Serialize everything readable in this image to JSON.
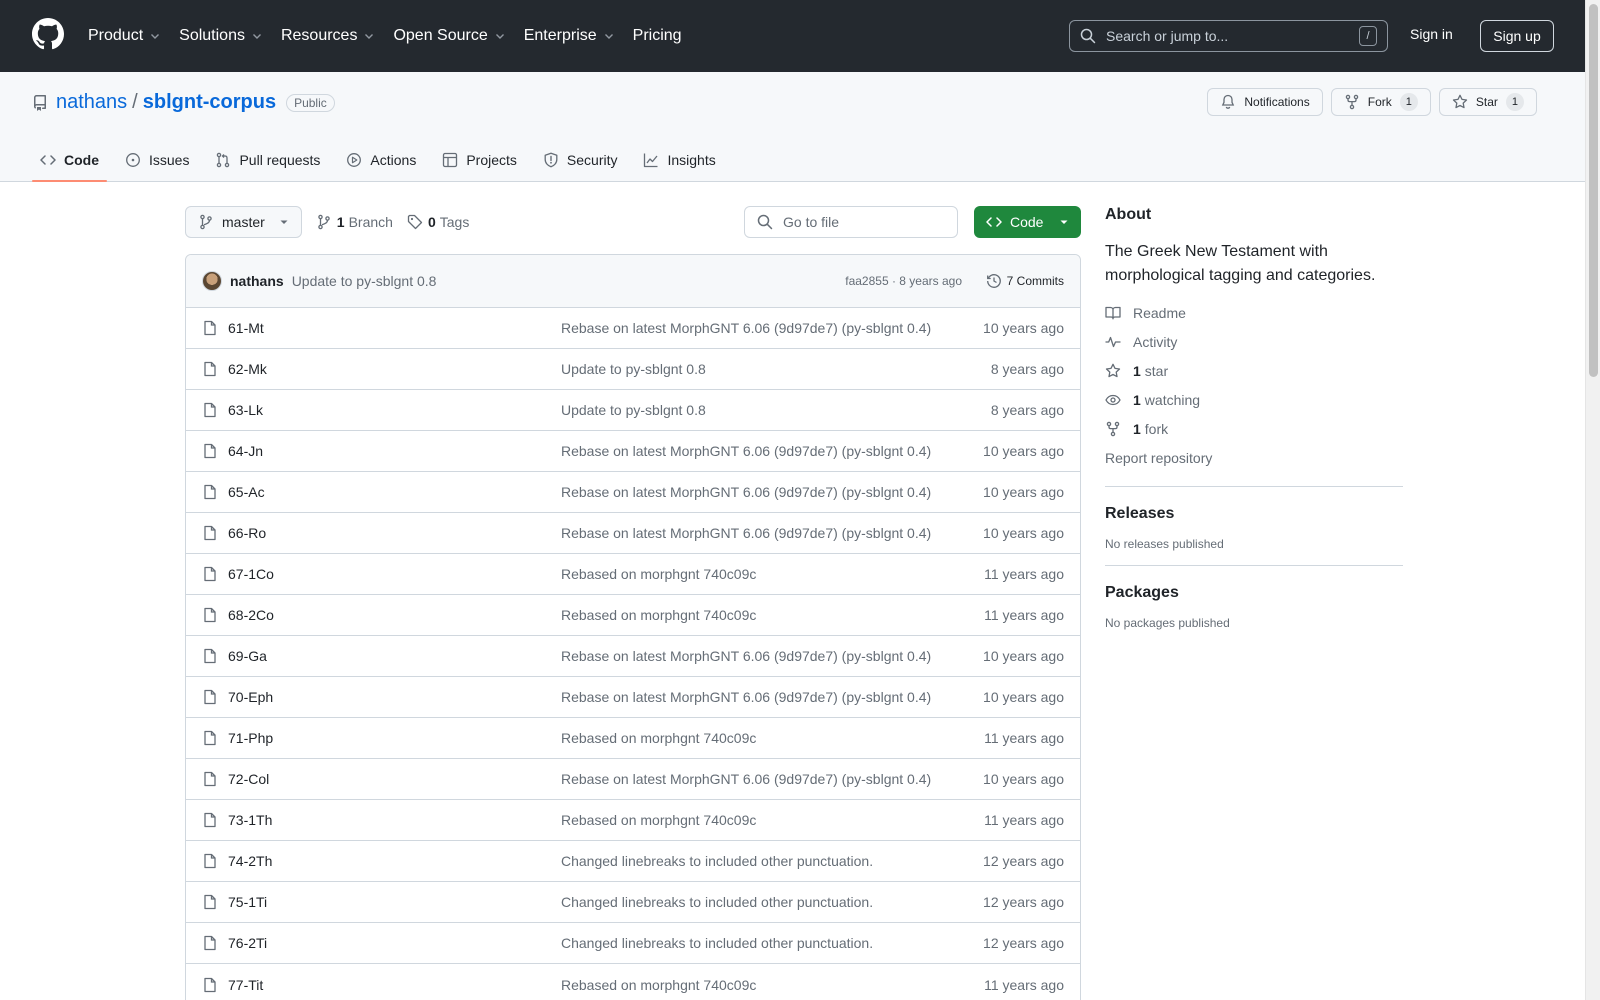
{
  "header": {
    "nav": [
      {
        "label": "Product",
        "has_menu": true
      },
      {
        "label": "Solutions",
        "has_menu": true
      },
      {
        "label": "Resources",
        "has_menu": true
      },
      {
        "label": "Open Source",
        "has_menu": true
      },
      {
        "label": "Enterprise",
        "has_menu": true
      },
      {
        "label": "Pricing",
        "has_menu": false
      }
    ],
    "search_placeholder": "Search or jump to...",
    "search_shortcut": "/",
    "sign_in": "Sign in",
    "sign_up": "Sign up"
  },
  "repo": {
    "owner": "nathans",
    "separator": "/",
    "name": "sblgnt-corpus",
    "visibility": "Public",
    "notifications_label": "Notifications",
    "fork_label": "Fork",
    "fork_count": "1",
    "star_label": "Star",
    "star_count": "1",
    "tabs": [
      {
        "label": "Code",
        "icon": "code-icon",
        "active": true
      },
      {
        "label": "Issues",
        "icon": "issue-icon",
        "active": false
      },
      {
        "label": "Pull requests",
        "icon": "pull-request-icon",
        "active": false
      },
      {
        "label": "Actions",
        "icon": "play-icon",
        "active": false
      },
      {
        "label": "Projects",
        "icon": "table-icon",
        "active": false
      },
      {
        "label": "Security",
        "icon": "shield-icon",
        "active": false
      },
      {
        "label": "Insights",
        "icon": "graph-icon",
        "active": false
      }
    ]
  },
  "file_nav": {
    "branch": "master",
    "branch_count": "1",
    "branch_label": "Branch",
    "tag_count": "0",
    "tag_label": "Tags",
    "goto_placeholder": "Go to file",
    "code_button": "Code"
  },
  "latest_commit": {
    "author": "nathans",
    "message": "Update to py-sblgnt 0.8",
    "meta": "faa2855 · 8 years ago",
    "commits_label": "7 Commits"
  },
  "files": [
    {
      "name": "61-Mt",
      "commit": "Rebase on latest MorphGNT 6.06 (9d97de7) (py-sblgnt 0.4)",
      "age": "10 years ago"
    },
    {
      "name": "62-Mk",
      "commit": "Update to py-sblgnt 0.8",
      "age": "8 years ago"
    },
    {
      "name": "63-Lk",
      "commit": "Update to py-sblgnt 0.8",
      "age": "8 years ago"
    },
    {
      "name": "64-Jn",
      "commit": "Rebase on latest MorphGNT 6.06 (9d97de7) (py-sblgnt 0.4)",
      "age": "10 years ago"
    },
    {
      "name": "65-Ac",
      "commit": "Rebase on latest MorphGNT 6.06 (9d97de7) (py-sblgnt 0.4)",
      "age": "10 years ago"
    },
    {
      "name": "66-Ro",
      "commit": "Rebase on latest MorphGNT 6.06 (9d97de7) (py-sblgnt 0.4)",
      "age": "10 years ago"
    },
    {
      "name": "67-1Co",
      "commit": "Rebased on morphgnt 740c09c",
      "age": "11 years ago"
    },
    {
      "name": "68-2Co",
      "commit": "Rebased on morphgnt 740c09c",
      "age": "11 years ago"
    },
    {
      "name": "69-Ga",
      "commit": "Rebase on latest MorphGNT 6.06 (9d97de7) (py-sblgnt 0.4)",
      "age": "10 years ago"
    },
    {
      "name": "70-Eph",
      "commit": "Rebase on latest MorphGNT 6.06 (9d97de7) (py-sblgnt 0.4)",
      "age": "10 years ago"
    },
    {
      "name": "71-Php",
      "commit": "Rebased on morphgnt 740c09c",
      "age": "11 years ago"
    },
    {
      "name": "72-Col",
      "commit": "Rebase on latest MorphGNT 6.06 (9d97de7) (py-sblgnt 0.4)",
      "age": "10 years ago"
    },
    {
      "name": "73-1Th",
      "commit": "Rebased on morphgnt 740c09c",
      "age": "11 years ago"
    },
    {
      "name": "74-2Th",
      "commit": "Changed linebreaks to included other punctuation.",
      "age": "12 years ago"
    },
    {
      "name": "75-1Ti",
      "commit": "Changed linebreaks to included other punctuation.",
      "age": "12 years ago"
    },
    {
      "name": "76-2Ti",
      "commit": "Changed linebreaks to included other punctuation.",
      "age": "12 years ago"
    },
    {
      "name": "77-Tit",
      "commit": "Rebased on morphgnt 740c09c",
      "age": "11 years ago"
    }
  ],
  "about": {
    "heading": "About",
    "description": "The Greek New Testament with morphological tagging and categories.",
    "readme": "Readme",
    "activity": "Activity",
    "stars_count": "1",
    "stars_label": "star",
    "watching_count": "1",
    "watching_label": "watching",
    "forks_count": "1",
    "forks_label": "fork",
    "report": "Report repository"
  },
  "releases": {
    "heading": "Releases",
    "empty": "No releases published"
  },
  "packages": {
    "heading": "Packages",
    "empty": "No packages published"
  },
  "colors": {
    "header_bg": "#24292f",
    "accent": "#0969da",
    "primary_button": "#1f883d",
    "active_tab_underline": "#fd8c73"
  }
}
